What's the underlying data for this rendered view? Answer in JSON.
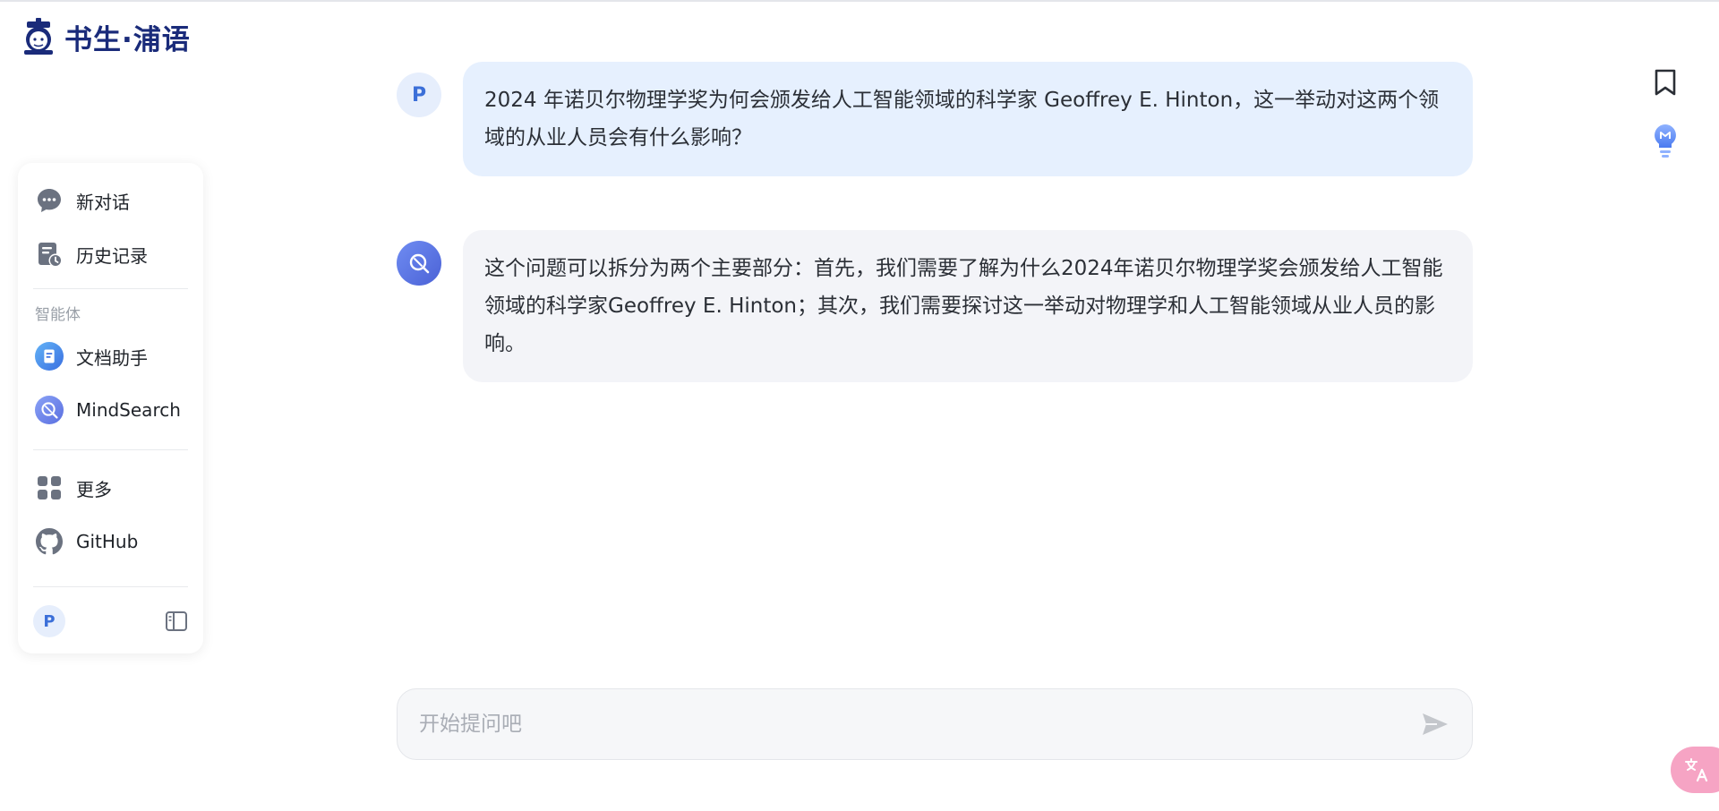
{
  "brand": {
    "name": "书生·浦语"
  },
  "sidebar": {
    "items": [
      {
        "label": "新对话",
        "icon": "chat-bubble-icon"
      },
      {
        "label": "历史记录",
        "icon": "history-icon"
      }
    ],
    "section_title": "智能体",
    "agents": [
      {
        "label": "文档助手",
        "icon": "document-assistant-icon"
      },
      {
        "label": "MindSearch",
        "icon": "mindsearch-icon"
      }
    ],
    "extras": [
      {
        "label": "更多",
        "icon": "grid-icon"
      },
      {
        "label": "GitHub",
        "icon": "github-icon"
      }
    ],
    "user_initial": "P"
  },
  "chat": {
    "messages": [
      {
        "role": "user",
        "avatar": "P",
        "text": "2024 年诺贝尔物理学奖为何会颁发给人工智能领域的科学家 Geoffrey E. Hinton，这一举动对这两个领域的从业人员会有什么影响？"
      },
      {
        "role": "assistant",
        "text": "这个问题可以拆分为两个主要部分：首先，我们需要了解为什么2024年诺贝尔物理学奖会颁发给人工智能领域的科学家Geoffrey E. Hinton；其次，我们需要探讨这一举动对物理学和人工智能领域从业人员的影响。"
      }
    ]
  },
  "composer": {
    "placeholder": "开始提问吧",
    "value": ""
  },
  "colors": {
    "accent": "#3b6fd8",
    "user_bubble": "#e6f0fe",
    "bot_bubble": "#f3f4f8",
    "brand_text": "#1a2b7a",
    "translate_fab": "#f6a4c4"
  }
}
